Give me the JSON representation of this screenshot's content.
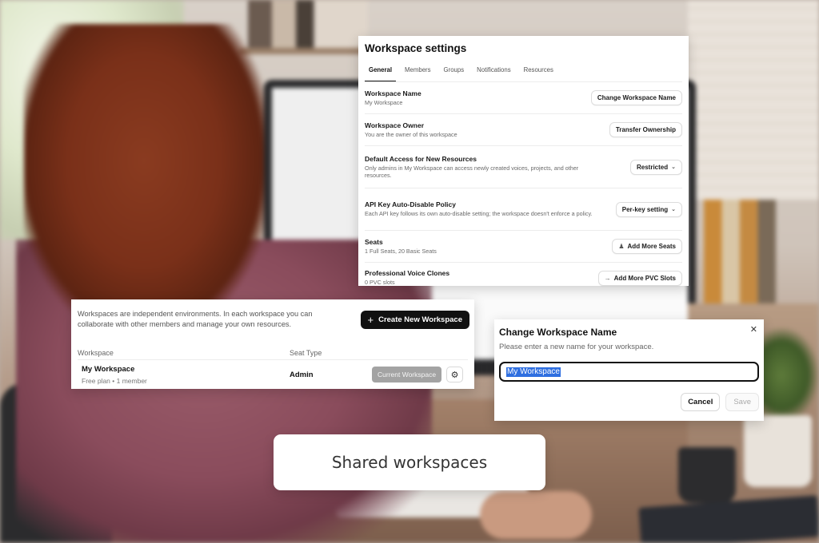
{
  "settings": {
    "title": "Workspace settings",
    "tabs": [
      "General",
      "Members",
      "Groups",
      "Notifications",
      "Resources"
    ],
    "active_tab": "General",
    "rows": [
      {
        "title": "Workspace Name",
        "desc": "My Workspace",
        "action": "Change Workspace Name"
      },
      {
        "title": "Workspace Owner",
        "desc": "You are the owner of this workspace",
        "action": "Transfer Ownership"
      },
      {
        "title": "Default Access for New Resources",
        "desc": "Only admins in My Workspace can access newly created voices, projects, and other resources.",
        "action": "Restricted",
        "action_icon": "chevron-down-icon"
      },
      {
        "title": "API Key Auto-Disable Policy",
        "desc": "Each API key follows its own auto-disable setting; the workspace doesn't enforce a policy.",
        "action": "Per-key setting",
        "action_icon": "chevron-down-icon"
      },
      {
        "title": "Seats",
        "desc": "1 Full Seats, 20 Basic Seats",
        "action": "Add More Seats",
        "action_icon": "user-plus-icon"
      },
      {
        "title": "Professional Voice Clones",
        "desc": "0 PVC slots",
        "action": "Add More PVC Slots",
        "action_icon": "voice-icon"
      }
    ]
  },
  "workspaces": {
    "intro": "Workspaces are independent environments. In each workspace you can collaborate with other members and manage your own resources.",
    "create_label": "Create New Workspace",
    "columns": {
      "workspace": "Workspace",
      "seat_type": "Seat Type"
    },
    "rows": [
      {
        "name": "My Workspace",
        "meta": "Free plan • 1 member",
        "seat_type": "Admin",
        "status_label": "Current Workspace"
      }
    ]
  },
  "dialog": {
    "title": "Change Workspace Name",
    "subtitle": "Please enter a new name for your workspace.",
    "input_value": "My Workspace",
    "cancel_label": "Cancel",
    "save_label": "Save"
  },
  "caption": "Shared workspaces",
  "colors": {
    "primary_button": "#111111",
    "disabled_button": "#a3a3a3",
    "selection": "#2f6fe0"
  }
}
